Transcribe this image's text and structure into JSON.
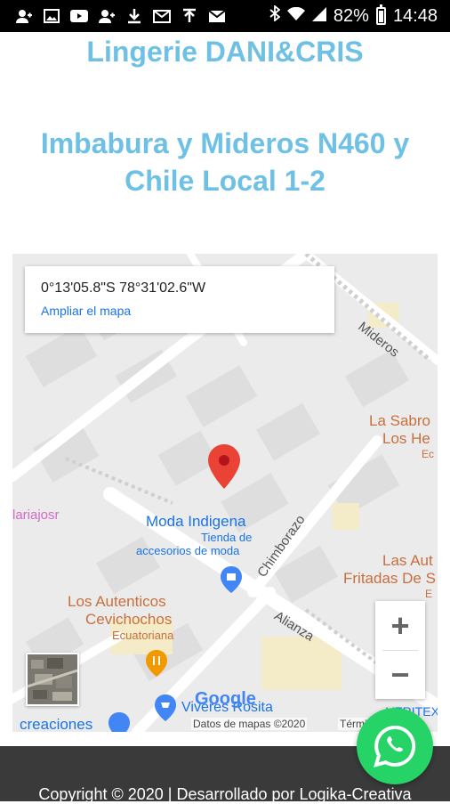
{
  "status_bar": {
    "battery": "82%",
    "time": "14:48",
    "icons": [
      "person-icon",
      "image-icon",
      "youtube-icon",
      "person-icon",
      "download-icon",
      "mail-icon",
      "upload-icon",
      "mail-icon",
      "bluetooth-icon",
      "wifi-icon",
      "signal-icon",
      "battery-icon"
    ]
  },
  "header": {
    "store_name": "Lingerie DANI&CRIS",
    "address_line1": "Imbabura y Mideros N460 y",
    "address_line2": "Chile Local 1-2"
  },
  "map": {
    "coordinates": "0°13'05.8\"S 78°31'02.6\"W",
    "view_larger": "Ampliar el mapa",
    "streets": {
      "mideros": "Mideros",
      "chimborazo": "Chimborazo",
      "alianza": "Alianza"
    },
    "places": {
      "moda_title": "Moda Indigena",
      "moda_sub1": "Tienda de",
      "moda_sub2": "accesorios de moda",
      "autenticos1": "Los Autenticos",
      "autenticos2": "Cevichochos",
      "autenticos_sub": "Ecuatoriana",
      "sabro1": "La Sabro",
      "sabro2": "Los He",
      "sabro3": "Ec",
      "fritadas1": "Las Aut",
      "fritadas2": "Fritadas De S",
      "fritadas3": "E",
      "mariajosr": "lariajosr",
      "viveres": "Viveres Rosita",
      "creaciones": "creaciones",
      "veritex": "VERITEX"
    },
    "google": "Google",
    "data_credit": "Datos de mapas ©2020",
    "terms": "Términos de",
    "zoom_in": "+",
    "zoom_out": "−"
  },
  "footer": {
    "copyright": "Copyright © 2020 | Desarrollado por Logika-Creativa"
  },
  "colors": {
    "title": "#6ec1e4",
    "whatsapp": "#25d366",
    "pin": "#ea4335",
    "link": "#1a73e8"
  }
}
